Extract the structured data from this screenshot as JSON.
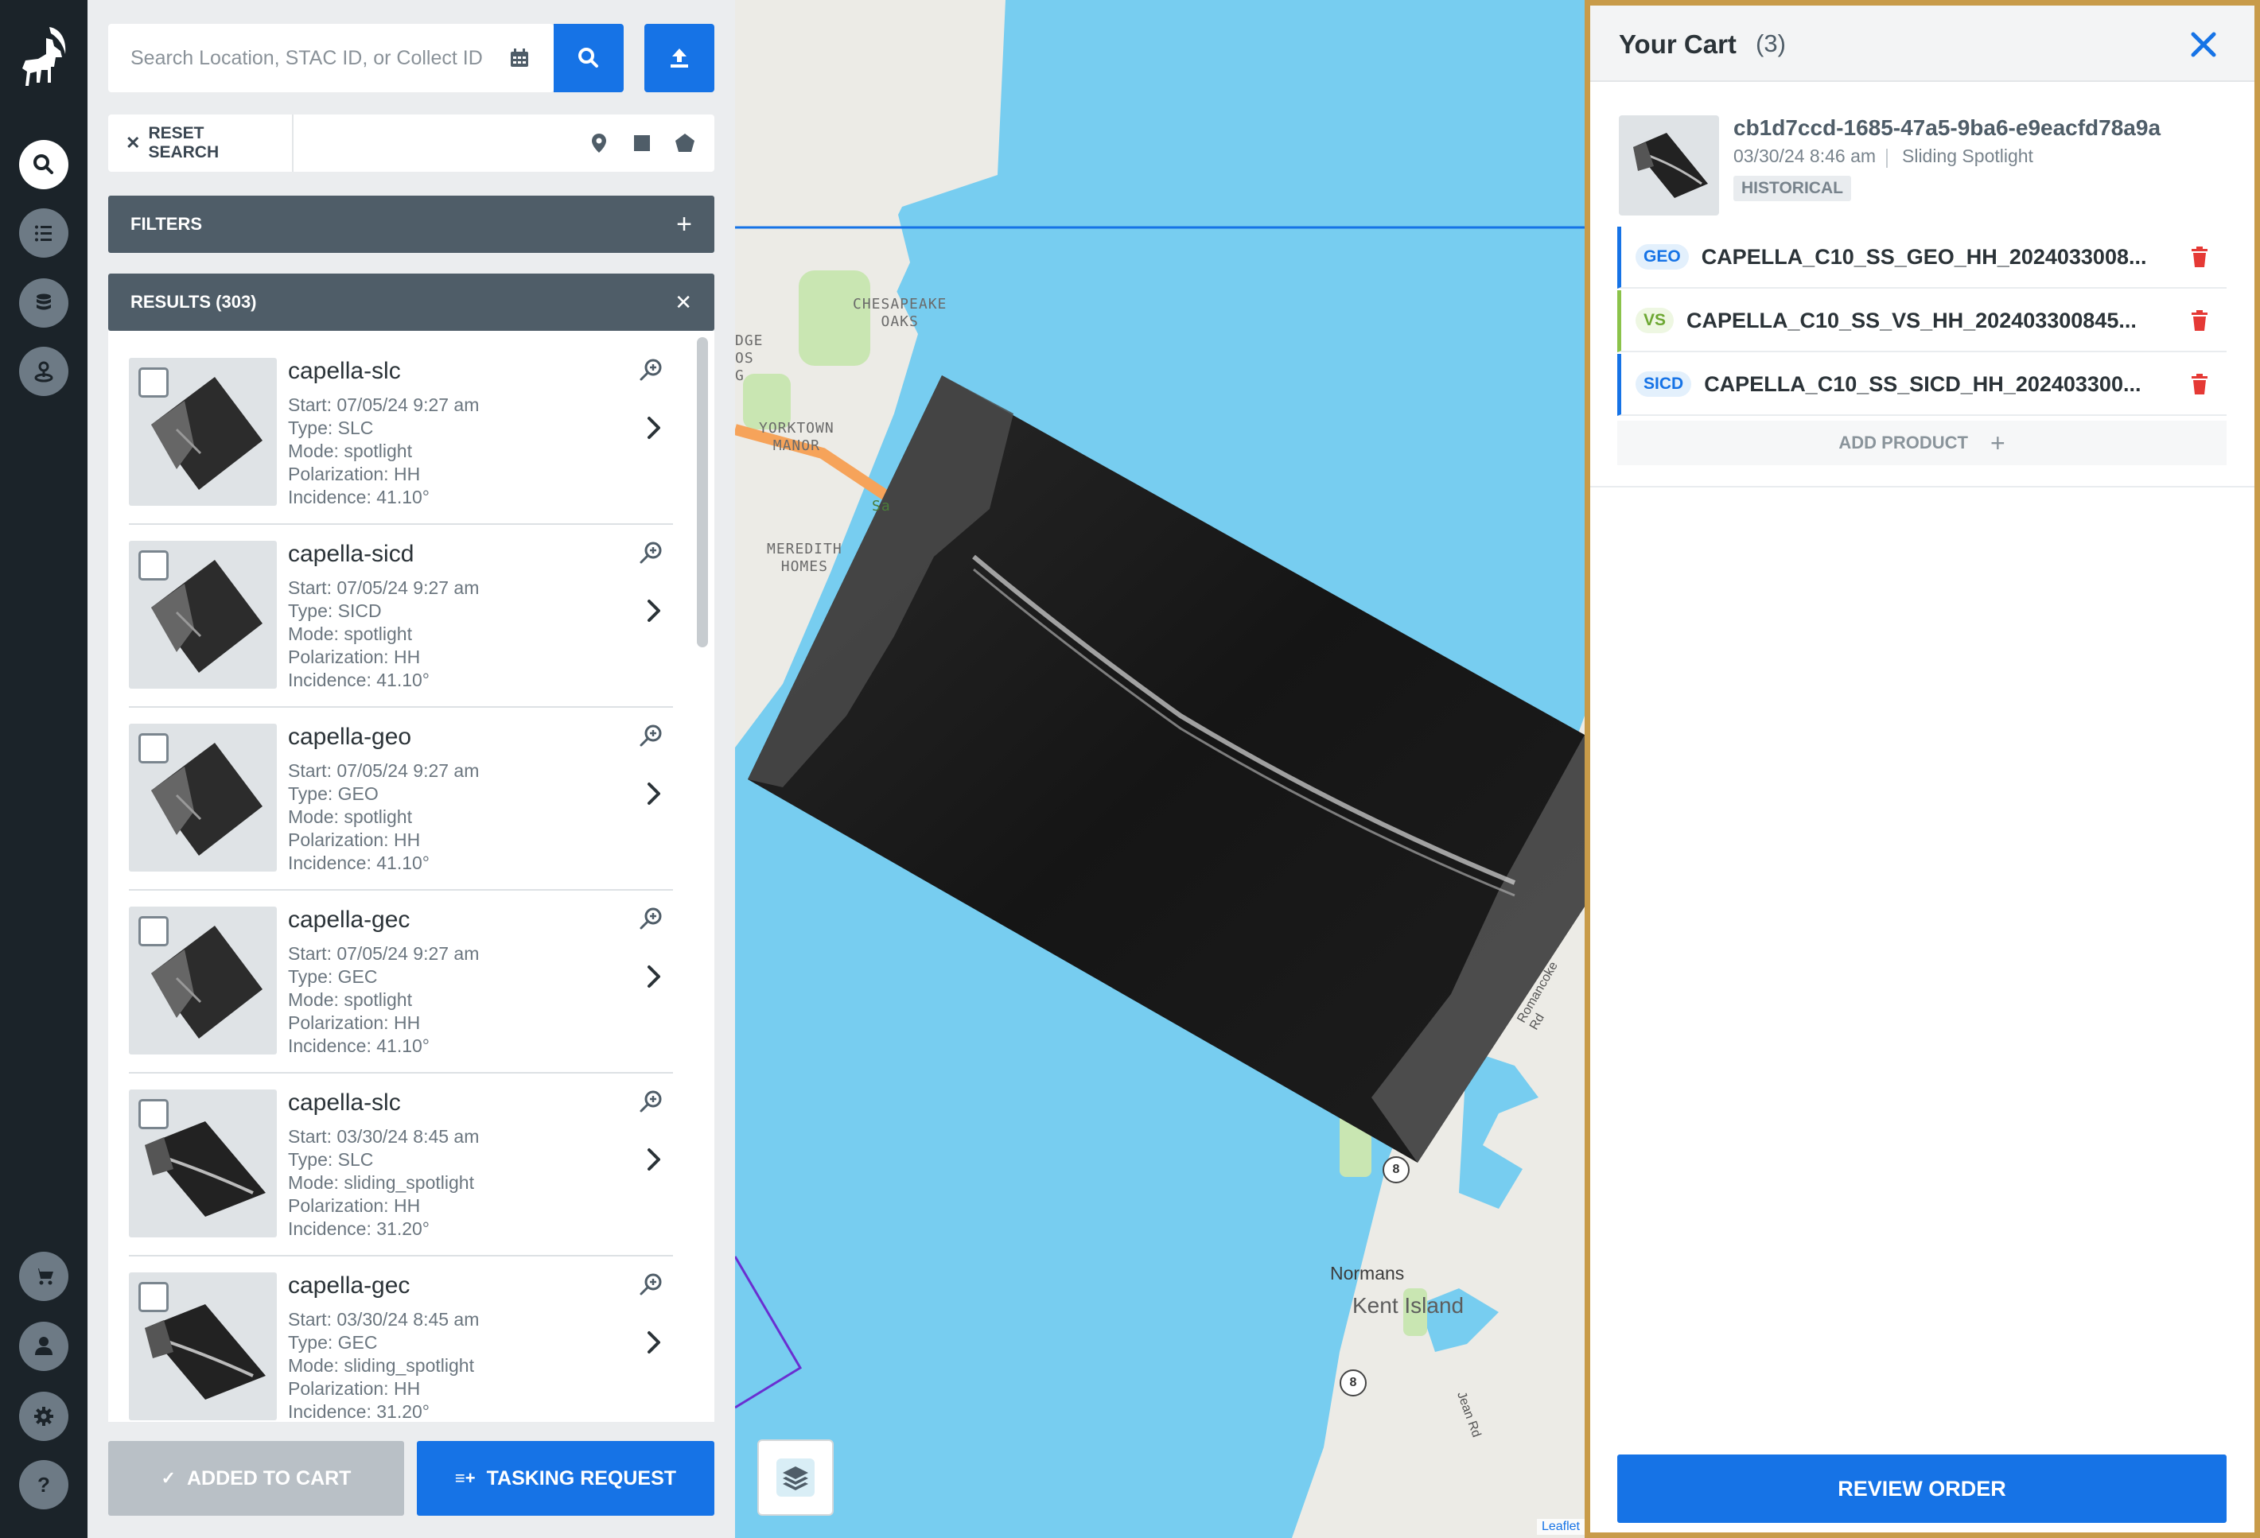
{
  "search": {
    "placeholder": "Search Location, STAC ID, or Collect ID",
    "reset_label": "RESET SEARCH"
  },
  "panels": {
    "filters_label": "FILTERS",
    "results_label": "RESULTS (303)"
  },
  "results": [
    {
      "title": "capella-slc",
      "start": "Start: 07/05/24 9:27 am",
      "type": "Type: SLC",
      "mode": "Mode: spotlight",
      "polarization": "Polarization: HH",
      "incidence": "Incidence: 41.10°"
    },
    {
      "title": "capella-sicd",
      "start": "Start: 07/05/24 9:27 am",
      "type": "Type: SICD",
      "mode": "Mode: spotlight",
      "polarization": "Polarization: HH",
      "incidence": "Incidence: 41.10°"
    },
    {
      "title": "capella-geo",
      "start": "Start: 07/05/24 9:27 am",
      "type": "Type: GEO",
      "mode": "Mode: spotlight",
      "polarization": "Polarization: HH",
      "incidence": "Incidence: 41.10°"
    },
    {
      "title": "capella-gec",
      "start": "Start: 07/05/24 9:27 am",
      "type": "Type: GEC",
      "mode": "Mode: spotlight",
      "polarization": "Polarization: HH",
      "incidence": "Incidence: 41.10°"
    },
    {
      "title": "capella-slc",
      "start": "Start: 03/30/24 8:45 am",
      "type": "Type: SLC",
      "mode": "Mode: sliding_spotlight",
      "polarization": "Polarization: HH",
      "incidence": "Incidence: 31.20°"
    },
    {
      "title": "capella-gec",
      "start": "Start: 03/30/24 8:45 am",
      "type": "Type: GEC",
      "mode": "Mode: sliding_spotlight",
      "polarization": "Polarization: HH",
      "incidence": "Incidence: 31.20°"
    }
  ],
  "bottom_buttons": {
    "added_label": "ADDED TO CART",
    "tasking_label": "TASKING REQUEST"
  },
  "map": {
    "labels": {
      "chesapeake": "CHESAPEAKE\nOAKS",
      "yorktown": "YORKTOWN\nMANOR",
      "meredith": "MEREDITH\nHOMES",
      "dge": "DGE\nOS\nG",
      "sa": "Sa",
      "normans": "Normans",
      "kent": "Kent Island",
      "route8a": "8",
      "route8b": "8",
      "jean": "Jean Rd",
      "romancoke": "Romancoke Rd"
    },
    "attribution": "Leaflet"
  },
  "cart": {
    "title": "Your Cart",
    "count": "(3)",
    "item": {
      "id": "cb1d7ccd-1685-47a5-9ba6-e9eacfd78a9a",
      "date": "03/30/24 8:46 am",
      "mode": "Sliding Spotlight",
      "badge": "HISTORICAL"
    },
    "products": [
      {
        "tag": "GEO",
        "name": "CAPELLA_C10_SS_GEO_HH_2024033008..."
      },
      {
        "tag": "VS",
        "name": "CAPELLA_C10_SS_VS_HH_202403300845..."
      },
      {
        "tag": "SICD",
        "name": "CAPELLA_C10_SS_SICD_HH_202403300..."
      }
    ],
    "add_product_label": "ADD PRODUCT",
    "review_label": "REVIEW ORDER"
  },
  "colors": {
    "nav_bg": "#1b2329",
    "accent": "#1673e6",
    "panel_header": "#4f5d68",
    "cart_border": "#c89b49",
    "delete": "#e53935",
    "water": "#77cdf0"
  }
}
